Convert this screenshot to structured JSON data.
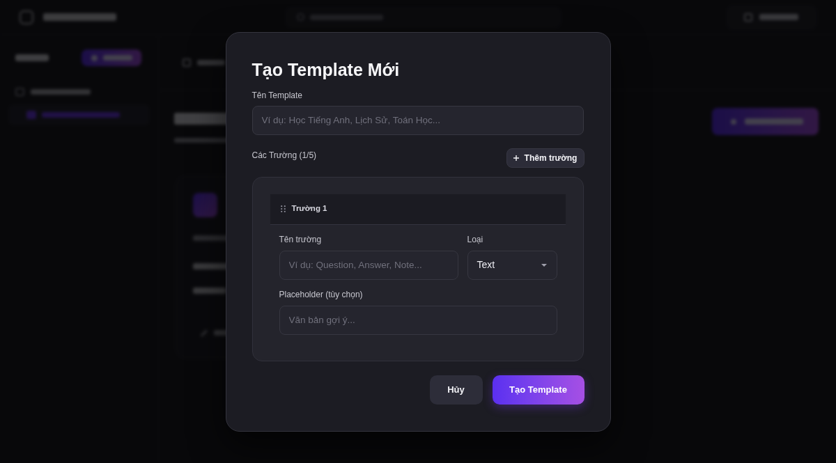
{
  "modal": {
    "title": "Tạo Template Mới",
    "name_field": {
      "label": "Tên Template",
      "placeholder": "Ví dụ: Học Tiếng Anh, Lịch Sử, Toán Học..."
    },
    "fields_label": "Các Trường (1/5)",
    "add_field_button": "Thêm trường",
    "fields": [
      {
        "title": "Trường 1",
        "name_input": {
          "label": "Tên trường",
          "placeholder": "Ví dụ: Question, Answer, Note..."
        },
        "type_select": {
          "label": "Loại",
          "value": "Text"
        },
        "placeholder_input": {
          "label": "Placeholder (tùy chọn)",
          "placeholder": "Văn bản gợi ý..."
        }
      }
    ],
    "buttons": [
      {
        "label": "Hủy",
        "kind": "secondary"
      },
      {
        "label": "Tạo Template",
        "kind": "primary"
      }
    ]
  }
}
